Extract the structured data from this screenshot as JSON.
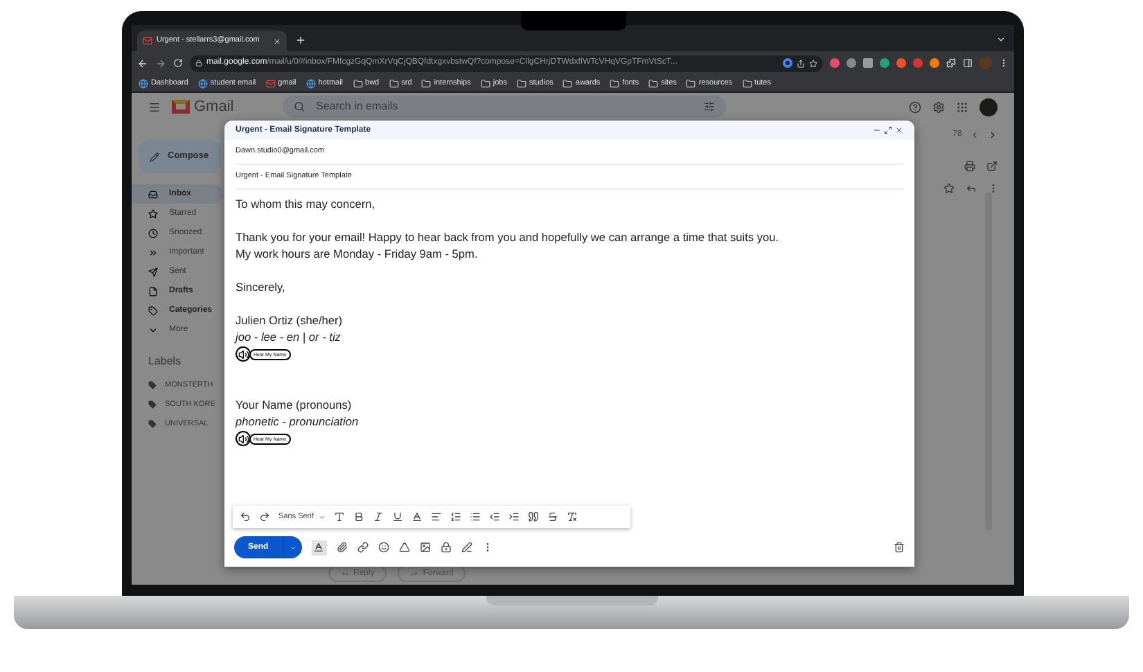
{
  "browser": {
    "tab": {
      "title": "Urgent - stellarrs3@gmail.com"
    },
    "url": {
      "host": "mail.google.com",
      "path": "/mail/u/0/#inbox/FMfcgzGqQmXrVqCjQBQfdtxgxvbstwQf?compose=CllgCHrjDTWdxfIWTcVHqVGpTFmVtScT..."
    },
    "bookmarks": [
      {
        "label": "Dashboard",
        "kind": "app"
      },
      {
        "label": "student email",
        "kind": "app"
      },
      {
        "label": "gmail",
        "kind": "mail"
      },
      {
        "label": "hotmail",
        "kind": "app"
      },
      {
        "label": "bwd",
        "kind": "folder"
      },
      {
        "label": "srd",
        "kind": "folder"
      },
      {
        "label": "internships",
        "kind": "folder"
      },
      {
        "label": "jobs",
        "kind": "folder"
      },
      {
        "label": "studios",
        "kind": "folder"
      },
      {
        "label": "awards",
        "kind": "folder"
      },
      {
        "label": "fonts",
        "kind": "folder"
      },
      {
        "label": "sites",
        "kind": "folder"
      },
      {
        "label": "resources",
        "kind": "folder"
      },
      {
        "label": "tutes",
        "kind": "folder"
      }
    ]
  },
  "gmail": {
    "logo": "Gmail",
    "search": {
      "placeholder": "Search in emails"
    },
    "compose": "Compose",
    "nav": [
      {
        "label": "Inbox",
        "bold": true,
        "selected": true
      },
      {
        "label": "Starred",
        "bold": false,
        "selected": false
      },
      {
        "label": "Snoozed",
        "bold": false,
        "selected": false
      },
      {
        "label": "Important",
        "bold": false,
        "selected": false
      },
      {
        "label": "Sent",
        "bold": false,
        "selected": false
      },
      {
        "label": "Drafts",
        "bold": true,
        "selected": false
      },
      {
        "label": "Categories",
        "bold": true,
        "selected": false
      },
      {
        "label": "More",
        "bold": false,
        "selected": false
      }
    ],
    "labels_heading": "Labels",
    "labels": [
      "MONSTERTH",
      "SOUTH KORE",
      "UNIVERSAL"
    ],
    "pagination": "78",
    "reply": "Reply",
    "forward": "Forward"
  },
  "compose": {
    "title": "Urgent - Email Signature Template",
    "to": "Dawn.studio0@gmail.com",
    "subject": "Urgent - Email Signature Template",
    "body": [
      {
        "kind": "text",
        "text": "To whom this may concern,"
      },
      {
        "kind": "gap"
      },
      {
        "kind": "text",
        "text": "Thank you for your email! Happy to hear back from you and hopefully we can arrange a time that suits you."
      },
      {
        "kind": "text",
        "text": "My work hours are Monday - Friday 9am - 5pm."
      },
      {
        "kind": "gap"
      },
      {
        "kind": "text",
        "text": "Sincerely,"
      },
      {
        "kind": "gap"
      },
      {
        "kind": "text",
        "text": "Julien Ortiz (she/her)"
      },
      {
        "kind": "italic",
        "text": "joo - lee - en | or - tiz"
      },
      {
        "kind": "hear",
        "text": "Hear My Name"
      },
      {
        "kind": "gap"
      },
      {
        "kind": "gap"
      },
      {
        "kind": "text",
        "text": "Your Name (pronouns)"
      },
      {
        "kind": "italic",
        "text": "phonetic - pronunciation"
      },
      {
        "kind": "hear",
        "text": "Hear My Name"
      }
    ],
    "font": "Sans Serif",
    "formatting_open": true,
    "send": "Send"
  }
}
